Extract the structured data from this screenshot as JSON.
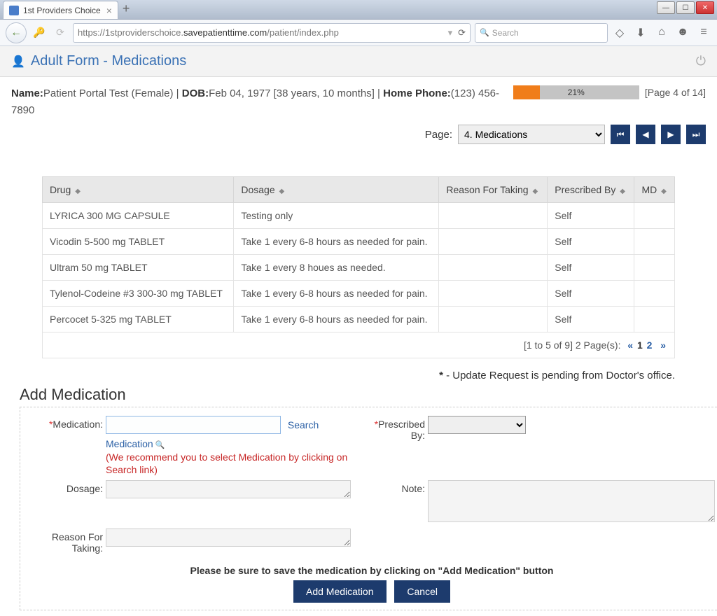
{
  "browser": {
    "tab_title": "1st Providers Choice",
    "url": {
      "pre": "https://1stproviderschoice.",
      "host": "savepatienttime.com",
      "post": "/patient/index.php"
    },
    "search_placeholder": "Search"
  },
  "page": {
    "title": "Adult Form - Medications",
    "patient": {
      "name_label": "Name:",
      "name_value": "Patient Portal Test (Female) | ",
      "dob_label": "DOB:",
      "dob_value": "Feb 04, 1977  [38 years, 10 months] | ",
      "phone_label": "Home Phone:",
      "phone_value": "(123) 456-7890"
    },
    "progress": {
      "percent": 21,
      "label": "21%",
      "page_label": "[Page 4 of 14]"
    },
    "pager": {
      "label": "Page:",
      "selected": "4. Medications"
    }
  },
  "table": {
    "cols": [
      "Drug",
      "Dosage",
      "Reason For Taking",
      "Prescribed By",
      "MD"
    ],
    "rows": [
      {
        "drug": "LYRICA 300 MG CAPSULE",
        "dosage": "Testing only",
        "reason": "",
        "by": "Self",
        "md": ""
      },
      {
        "drug": "Vicodin 5-500 mg TABLET",
        "dosage": "Take 1 every 6-8 hours as needed for pain.",
        "reason": "",
        "by": "Self",
        "md": ""
      },
      {
        "drug": "Ultram 50 mg TABLET",
        "dosage": "Take 1 every 8 houes as needed.",
        "reason": "",
        "by": "Self",
        "md": ""
      },
      {
        "drug": "Tylenol-Codeine #3 300-30 mg TABLET",
        "dosage": "Take 1 every 6-8 hours as needed for pain.",
        "reason": "",
        "by": "Self",
        "md": ""
      },
      {
        "drug": "Percocet 5-325 mg TABLET",
        "dosage": "Take 1 every 6-8 hours as needed for pain.",
        "reason": "",
        "by": "Self",
        "md": ""
      }
    ],
    "footer": {
      "range": "[1 to 5 of 9] 2 Page(s):",
      "prev": "«",
      "p1": "1",
      "p2": "2",
      "next": "»"
    }
  },
  "pending_note": " - Update Request is pending from Doctor's office.",
  "pending_star": "*",
  "form": {
    "heading": "Add Medication",
    "medication_label": "Medication:",
    "search_link": "Search",
    "med_link": "Medication",
    "recommend": "(We recommend you to select Medication by clicking on Search link)",
    "prescribed_label": "Prescribed By:",
    "dosage_label": "Dosage:",
    "note_label": "Note:",
    "reason_label": "Reason For Taking:",
    "save_hint": "Please be sure to save the medication by clicking on \"Add Medication\" button",
    "add_btn": "Add Medication",
    "cancel_btn": "Cancel"
  }
}
